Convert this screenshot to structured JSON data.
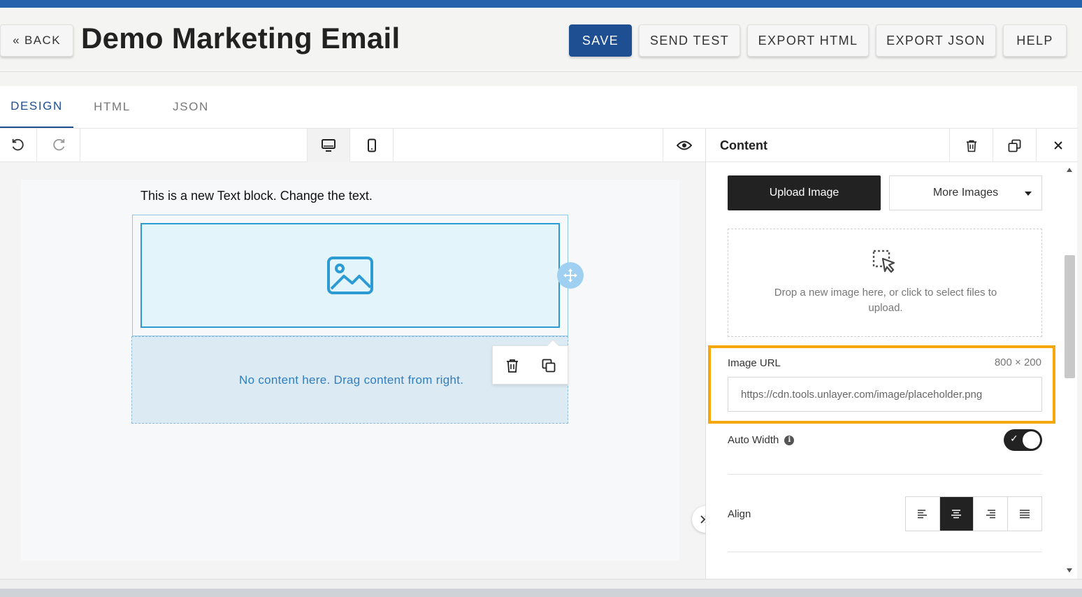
{
  "header": {
    "back_label": "« BACK",
    "title": "Demo Marketing Email",
    "buttons": {
      "save": "SAVE",
      "send_test": "SEND TEST",
      "export_html": "EXPORT HTML",
      "export_json": "EXPORT JSON",
      "help": "HELP"
    }
  },
  "tabs": [
    {
      "label": "DESIGN",
      "active": true
    },
    {
      "label": "HTML",
      "active": false
    },
    {
      "label": "JSON",
      "active": false
    }
  ],
  "toolbar": {
    "icons": [
      "undo-icon",
      "redo-icon",
      "desktop-icon",
      "mobile-icon",
      "eye-icon"
    ],
    "selected_view": "desktop"
  },
  "canvas": {
    "text_block": "This is a new Text block. Change the text.",
    "image_placeholder_icon": "image-icon",
    "empty_row_text": "No content here. Drag content from right."
  },
  "panel": {
    "title": "Content",
    "upload_label": "Upload Image",
    "more_images_label": "More Images",
    "dropzone_text": "Drop a new image here, or click to select files to upload.",
    "image_url_label": "Image URL",
    "image_dims": "800 × 200",
    "image_url_value": "https://cdn.tools.unlayer.com/image/placeholder.png",
    "auto_width_label": "Auto Width",
    "auto_width_on": true,
    "align_label": "Align",
    "align_options": [
      "left",
      "center",
      "right",
      "justify"
    ],
    "align_selected": "center"
  },
  "colors": {
    "brand": "#1e4f93",
    "top_stripe": "#2563ad",
    "highlight": "#f5a70b",
    "image_block": "#e3f4fb"
  }
}
